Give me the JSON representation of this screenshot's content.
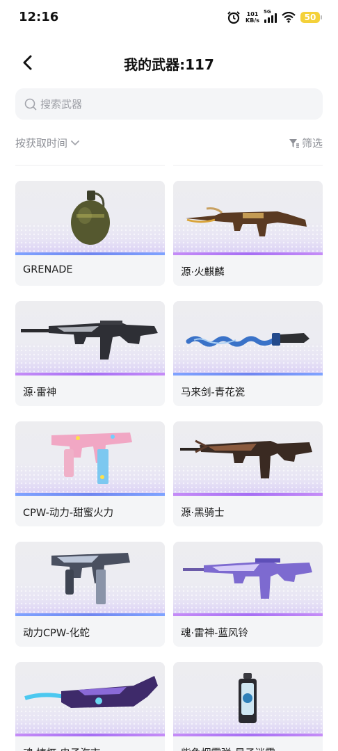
{
  "status_bar": {
    "time": "12:16",
    "net_speed_value": "101",
    "net_speed_unit": "KB/s",
    "network": "5G",
    "battery": "50"
  },
  "header": {
    "back_icon": "chevron-left-icon",
    "title": "我的武器:117"
  },
  "search": {
    "placeholder": "搜索武器",
    "value": ""
  },
  "sort": {
    "label": "按获取时间",
    "icon": "chevron-down-icon"
  },
  "filter": {
    "label": "筛选",
    "icon": "funnel-icon"
  },
  "weapons": [
    {
      "name": "GRENADE",
      "accent": "#6f86f0"
    },
    {
      "name": "源·火麒麟",
      "accent": "#b07bf5"
    },
    {
      "name": "源·雷神",
      "accent": "#b07bf5"
    },
    {
      "name": "马来剑-青花瓷",
      "accent": "#6f86f0"
    },
    {
      "name": "CPW-动力-甜蜜火力",
      "accent": "#6f86f0"
    },
    {
      "name": "源·黑骑士",
      "accent": "#b07bf5"
    },
    {
      "name": "动力CPW-化蛇",
      "accent": "#6f86f0"
    },
    {
      "name": "魂·雷神-蓝风铃",
      "accent": "#b07bf5"
    },
    {
      "name": "魂·梼杌-电子海市",
      "accent": "#b07bf5"
    },
    {
      "name": "紫色烟雾弹-星子迷雾",
      "accent": "#b07bf5"
    }
  ]
}
